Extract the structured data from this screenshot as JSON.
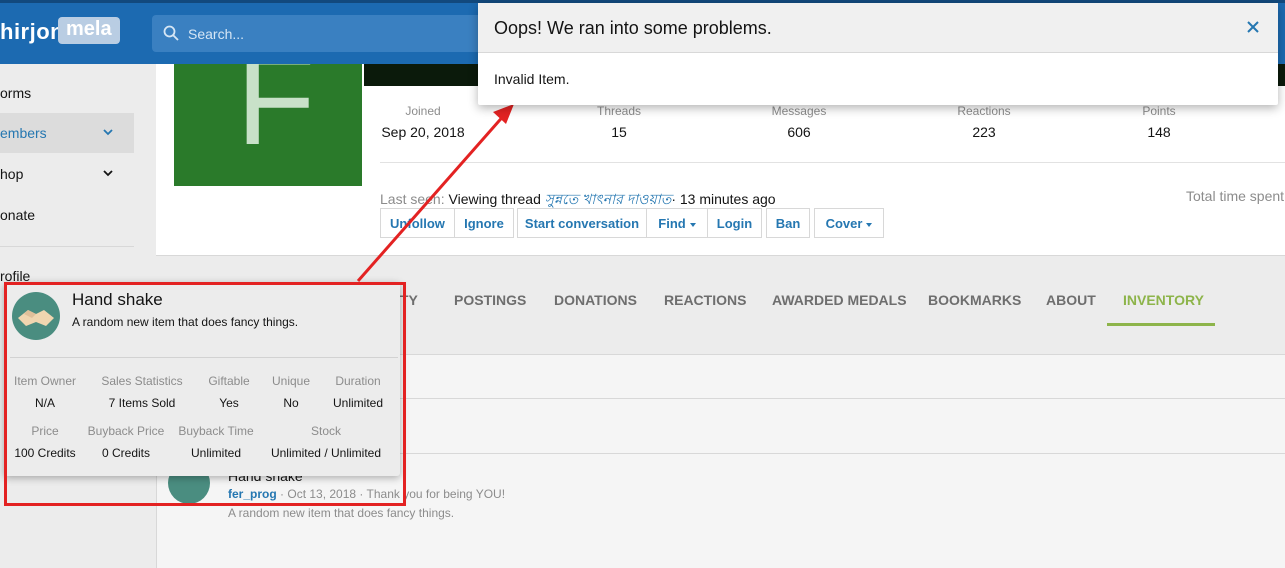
{
  "header": {
    "logo_part1": "hirjon",
    "logo_part2": "mela",
    "search_placeholder": "Search..."
  },
  "nav": {
    "items": [
      {
        "label": "orms"
      },
      {
        "label": "embers"
      },
      {
        "label": "hop"
      },
      {
        "label": "onate"
      },
      {
        "label": "rofile"
      }
    ]
  },
  "profile": {
    "avatar_letter": "F",
    "stats": [
      {
        "label": "Joined",
        "value": "Sep 20, 2018"
      },
      {
        "label": "Threads",
        "value": "15"
      },
      {
        "label": "Messages",
        "value": "606"
      },
      {
        "label": "Reactions",
        "value": "223"
      },
      {
        "label": "Points",
        "value": "148"
      }
    ],
    "last_seen_label": "Last seen:",
    "last_seen_text": "Viewing thread",
    "last_seen_thread": "সুন্নতে খাৎনার দাওয়াত",
    "last_seen_time": "· 13 minutes ago",
    "total_time_label": "Total time spent",
    "buttons": {
      "unfollow": "Unfollow",
      "ignore": "Ignore",
      "start_conversation": "Start conversation",
      "find": "Find",
      "login": "Login",
      "ban": "Ban",
      "cover": "Cover"
    }
  },
  "tabs": [
    {
      "label": "ITY"
    },
    {
      "label": "POSTINGS"
    },
    {
      "label": "DONATIONS"
    },
    {
      "label": "REACTIONS"
    },
    {
      "label": "AWARDED MEDALS"
    },
    {
      "label": "BOOKMARKS"
    },
    {
      "label": "ABOUT"
    },
    {
      "label": "INVENTORY"
    }
  ],
  "feed": {
    "title": "Hand shake",
    "user": "fer_prog",
    "meta": "· Oct 13, 2018 · Thank you for being YOU!",
    "description": "A random new item that does fancy things."
  },
  "tooltip": {
    "title": "Hand shake",
    "description": "A random new item that does fancy things.",
    "row1": [
      {
        "header": "Item Owner",
        "value": "N/A"
      },
      {
        "header": "Sales Statistics",
        "value": "7 Items Sold"
      },
      {
        "header": "Giftable",
        "value": "Yes"
      },
      {
        "header": "Unique",
        "value": "No"
      },
      {
        "header": "Duration",
        "value": "Unlimited"
      }
    ],
    "row2": [
      {
        "header": "Price",
        "value": "100 Credits"
      },
      {
        "header": "Buyback Price",
        "value": "0 Credits"
      },
      {
        "header": "Buyback Time",
        "value": "Unlimited"
      },
      {
        "header": "Stock",
        "value": "Unlimited / Unlimited"
      }
    ]
  },
  "modal": {
    "title": "Oops! We ran into some problems.",
    "message": "Invalid Item."
  },
  "colors": {
    "brand": "#1c6ab1",
    "link": "#2577b1",
    "active_tab": "#8db44a",
    "annotation": "#e32222",
    "avatar": "#2a7a2a"
  }
}
